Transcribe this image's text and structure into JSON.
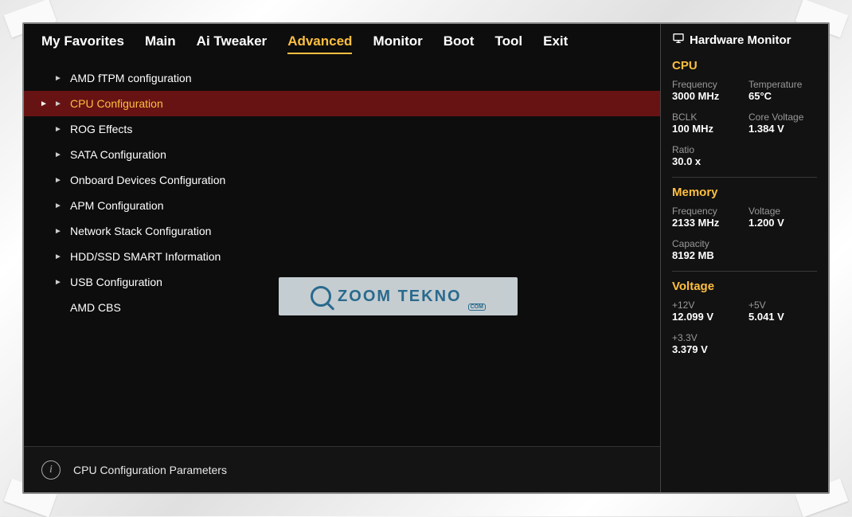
{
  "tabs": [
    {
      "label": "My Favorites",
      "active": false
    },
    {
      "label": "Main",
      "active": false
    },
    {
      "label": "Ai Tweaker",
      "active": false
    },
    {
      "label": "Advanced",
      "active": true
    },
    {
      "label": "Monitor",
      "active": false
    },
    {
      "label": "Boot",
      "active": false
    },
    {
      "label": "Tool",
      "active": false
    },
    {
      "label": "Exit",
      "active": false
    }
  ],
  "menu": {
    "items": [
      {
        "label": "AMD fTPM configuration",
        "arrow": true,
        "selected": false
      },
      {
        "label": "CPU Configuration",
        "arrow": true,
        "selected": true
      },
      {
        "label": "ROG Effects",
        "arrow": true,
        "selected": false
      },
      {
        "label": "SATA Configuration",
        "arrow": true,
        "selected": false
      },
      {
        "label": "Onboard Devices Configuration",
        "arrow": true,
        "selected": false
      },
      {
        "label": "APM Configuration",
        "arrow": true,
        "selected": false
      },
      {
        "label": "Network Stack Configuration",
        "arrow": true,
        "selected": false
      },
      {
        "label": "HDD/SSD SMART Information",
        "arrow": true,
        "selected": false
      },
      {
        "label": "USB Configuration",
        "arrow": true,
        "selected": false
      },
      {
        "label": "AMD CBS",
        "arrow": false,
        "selected": false
      }
    ]
  },
  "help_text": "CPU Configuration Parameters",
  "sidebar": {
    "title": "Hardware Monitor",
    "sections": [
      {
        "title": "CPU",
        "rows": [
          [
            {
              "label": "Frequency",
              "value": "3000 MHz"
            },
            {
              "label": "Temperature",
              "value": "65°C"
            }
          ],
          [
            {
              "label": "BCLK",
              "value": "100 MHz"
            },
            {
              "label": "Core Voltage",
              "value": "1.384 V"
            }
          ],
          [
            {
              "label": "Ratio",
              "value": "30.0 x"
            },
            null
          ]
        ]
      },
      {
        "title": "Memory",
        "rows": [
          [
            {
              "label": "Frequency",
              "value": "2133 MHz"
            },
            {
              "label": "Voltage",
              "value": "1.200 V"
            }
          ],
          [
            {
              "label": "Capacity",
              "value": "8192 MB"
            },
            null
          ]
        ]
      },
      {
        "title": "Voltage",
        "rows": [
          [
            {
              "label": "+12V",
              "value": "12.099 V"
            },
            {
              "label": "+5V",
              "value": "5.041 V"
            }
          ],
          [
            {
              "label": "+3.3V",
              "value": "3.379 V"
            },
            null
          ]
        ]
      }
    ]
  },
  "watermark": {
    "text": "ZOOM TEKNO",
    "sub": "COM"
  }
}
